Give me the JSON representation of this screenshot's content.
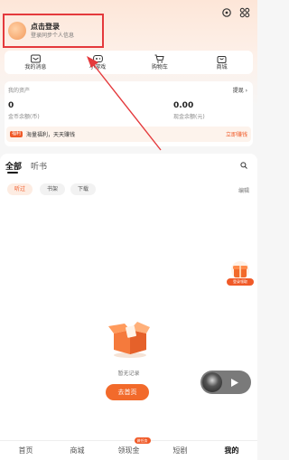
{
  "header": {
    "login_title": "点击登录",
    "login_subtitle": "登录同步个人信息",
    "icons": [
      "settings-icon",
      "grid-icon"
    ]
  },
  "quick_nav": [
    {
      "label": "我的消息",
      "icon": "mail-icon"
    },
    {
      "label": "小游戏",
      "icon": "gamepad-icon"
    },
    {
      "label": "购物车",
      "icon": "cart-icon"
    },
    {
      "label": "商城",
      "icon": "shop-icon"
    }
  ],
  "assets": {
    "title": "我的资产",
    "withdraw": "提现 ›",
    "coin_value": "0",
    "coin_label": "金币余额(币)",
    "cash_value": "0.00",
    "cash_label": "现金余额(元)",
    "promo_tag": "福利",
    "promo_text": "海量福利，天天赚钱",
    "promo_button": "立即赚钱"
  },
  "tabs": {
    "all": "全部",
    "audio": "听书",
    "chips": [
      "听过",
      "书架",
      "下载"
    ],
    "edit": "编辑"
  },
  "empty": {
    "text": "暂无记录",
    "button": "去首页"
  },
  "float_reward": {
    "label": "登录领取"
  },
  "bottom_nav": {
    "items": [
      "首页",
      "商城",
      "领现金",
      "短剧",
      "我的"
    ],
    "badge": "做任务"
  },
  "colors": {
    "accent": "#f05a28",
    "annotation": "#e4393c"
  }
}
